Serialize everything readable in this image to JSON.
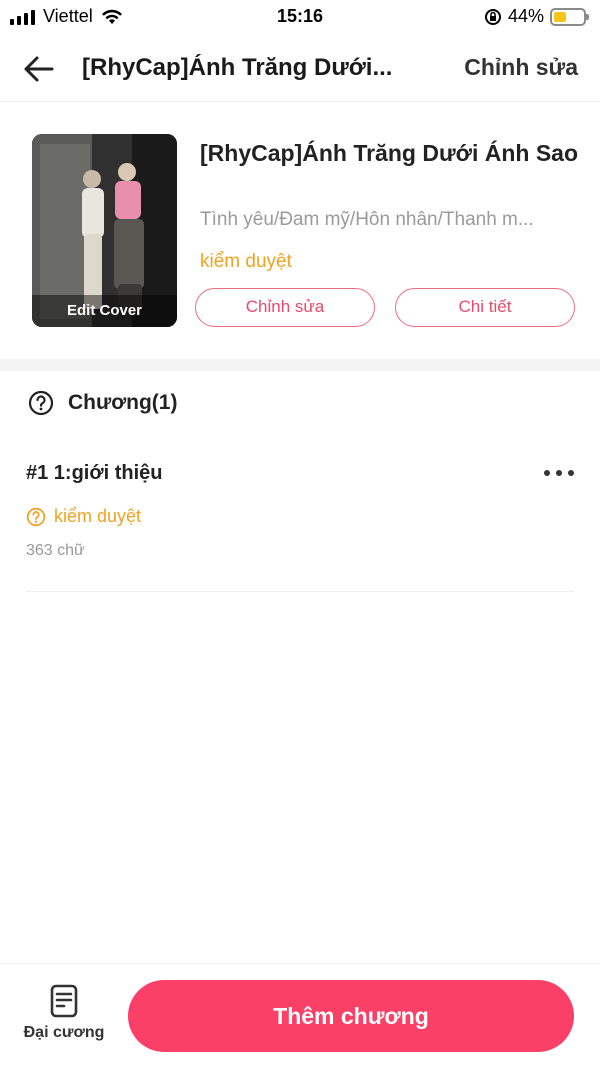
{
  "status_bar": {
    "carrier": "Viettel",
    "time": "15:16",
    "battery": "44%",
    "battery_level": 0.44
  },
  "header": {
    "title": "[RhyCap]Ánh Trăng Dưới...",
    "edit_label": "Chỉnh sửa"
  },
  "book": {
    "cover_caption": "Edit Cover",
    "title": "[RhyCap]Ánh Trăng Dưới Ánh Sao",
    "genres": "Tình yêu/Đam mỹ/Hôn nhân/Thanh m...",
    "status": "kiểm duyệt",
    "edit_button": "Chỉnh sửa",
    "detail_button": "Chi tiết"
  },
  "chapters": {
    "heading": "Chương(1)",
    "items": [
      {
        "title": "#1 1:giới thiệu",
        "status": "kiểm duyệt",
        "word_count": "363 chữ"
      }
    ]
  },
  "bottom_bar": {
    "outline_label": "Đại cương",
    "add_chapter_label": "Thêm chương"
  },
  "colors": {
    "accent": "#fb4068",
    "pill_border": "#f06a85",
    "status_orange": "#f0a422"
  },
  "icons": {
    "back": "arrow-left-icon",
    "question": "question-circle-icon",
    "more": "more-horizontal-icon",
    "outline": "document-icon"
  }
}
